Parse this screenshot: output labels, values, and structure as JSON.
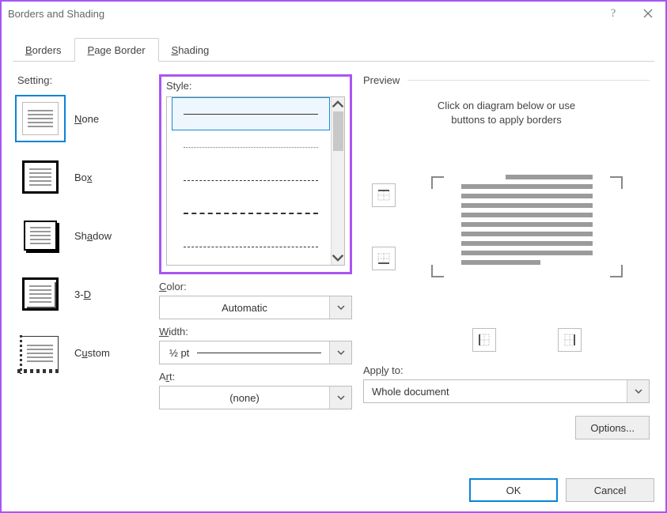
{
  "title": "Borders and Shading",
  "tabs": {
    "borders": {
      "pre": "",
      "u": "B",
      "post": "orders"
    },
    "pageBorder": {
      "pre": "",
      "u": "P",
      "post": "age Border"
    },
    "shading": {
      "pre": "",
      "u": "S",
      "post": "hading"
    }
  },
  "setting": {
    "label": "Setting:",
    "items": {
      "none": {
        "pre": "",
        "u": "N",
        "post": "one"
      },
      "box": {
        "pre": "Bo",
        "u": "x",
        "post": ""
      },
      "shadow": {
        "pre": "Sh",
        "u": "a",
        "post": "dow"
      },
      "threeD": {
        "pre": "3-",
        "u": "D",
        "post": ""
      },
      "custom": {
        "pre": "C",
        "u": "u",
        "post": "stom"
      }
    }
  },
  "style": {
    "label_pre": "St",
    "label_u": "y",
    "label_post": "le:"
  },
  "color": {
    "label_u": "C",
    "label_post": "olor:",
    "value": "Automatic"
  },
  "width": {
    "label_u": "W",
    "label_post": "idth:",
    "value": "½ pt"
  },
  "art": {
    "label_pre": "A",
    "label_u": "r",
    "label_post": "t:",
    "value": "(none)"
  },
  "preview": {
    "label": "Preview",
    "hint_line1": "Click on diagram below or use",
    "hint_line2": "buttons to apply borders"
  },
  "applyTo": {
    "label_pre": "App",
    "label_u": "l",
    "label_post": "y to:",
    "value": "Whole document"
  },
  "optionsBtn": {
    "pre": "",
    "u": "O",
    "post": "ptions..."
  },
  "footer": {
    "ok": "OK",
    "cancel": "Cancel"
  }
}
